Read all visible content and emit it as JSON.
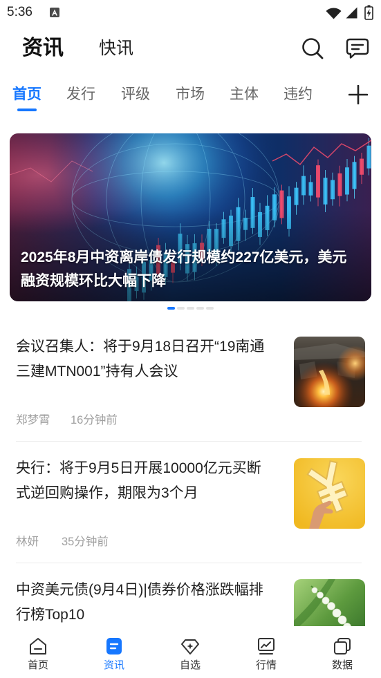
{
  "status_bar": {
    "time": "5:36",
    "icons": [
      "notification-icon",
      "wifi-icon",
      "signal-icon",
      "battery-charging-icon"
    ]
  },
  "header": {
    "tabs": [
      {
        "label": "资讯",
        "active": true
      },
      {
        "label": "快讯",
        "active": false
      }
    ],
    "actions": [
      {
        "icon": "search-icon"
      },
      {
        "icon": "message-icon"
      }
    ]
  },
  "channels": {
    "items": [
      {
        "label": "首页",
        "active": true
      },
      {
        "label": "发行",
        "active": false
      },
      {
        "label": "评级",
        "active": false
      },
      {
        "label": "市场",
        "active": false
      },
      {
        "label": "主体",
        "active": false
      },
      {
        "label": "违约",
        "active": false
      }
    ],
    "add_icon": "plus-icon"
  },
  "banner": {
    "title": "2025年8月中资离岸债发行规模约227亿美元，美元融资规模环比大幅下降",
    "image": "financial-globe-candlestick-image",
    "slides": 5,
    "active_slide": 1
  },
  "news": [
    {
      "title": "会议召集人：将于9月18日召开“19南通三建MTN001”持有人会议",
      "author": "郑梦霄",
      "time": "16分钟前",
      "thumbnail": "molten-steel-image"
    },
    {
      "title": "央行：将于9月5日开展10000亿元买断式逆回购操作，期限为3个月",
      "author": "林妍",
      "time": "35分钟前",
      "thumbnail": "hand-holding-yuan-image"
    },
    {
      "title": "中资美元债(9月4日)|债券价格涨跌幅排行榜Top10",
      "thumbnail": "lily-of-the-valley-image"
    }
  ],
  "bottom_nav": {
    "items": [
      {
        "label": "首页",
        "icon": "home-icon",
        "active": false
      },
      {
        "label": "资讯",
        "icon": "news-icon",
        "active": true
      },
      {
        "label": "自选",
        "icon": "watchlist-icon",
        "active": false
      },
      {
        "label": "行情",
        "icon": "market-chart-icon",
        "active": false
      },
      {
        "label": "数据",
        "icon": "data-icon",
        "active": false
      }
    ]
  },
  "colors": {
    "accent": "#1677ff",
    "text": "#1f1f1f",
    "muted": "#a0a0a0",
    "tab_inactive": "#666666",
    "divider": "#ececec"
  }
}
